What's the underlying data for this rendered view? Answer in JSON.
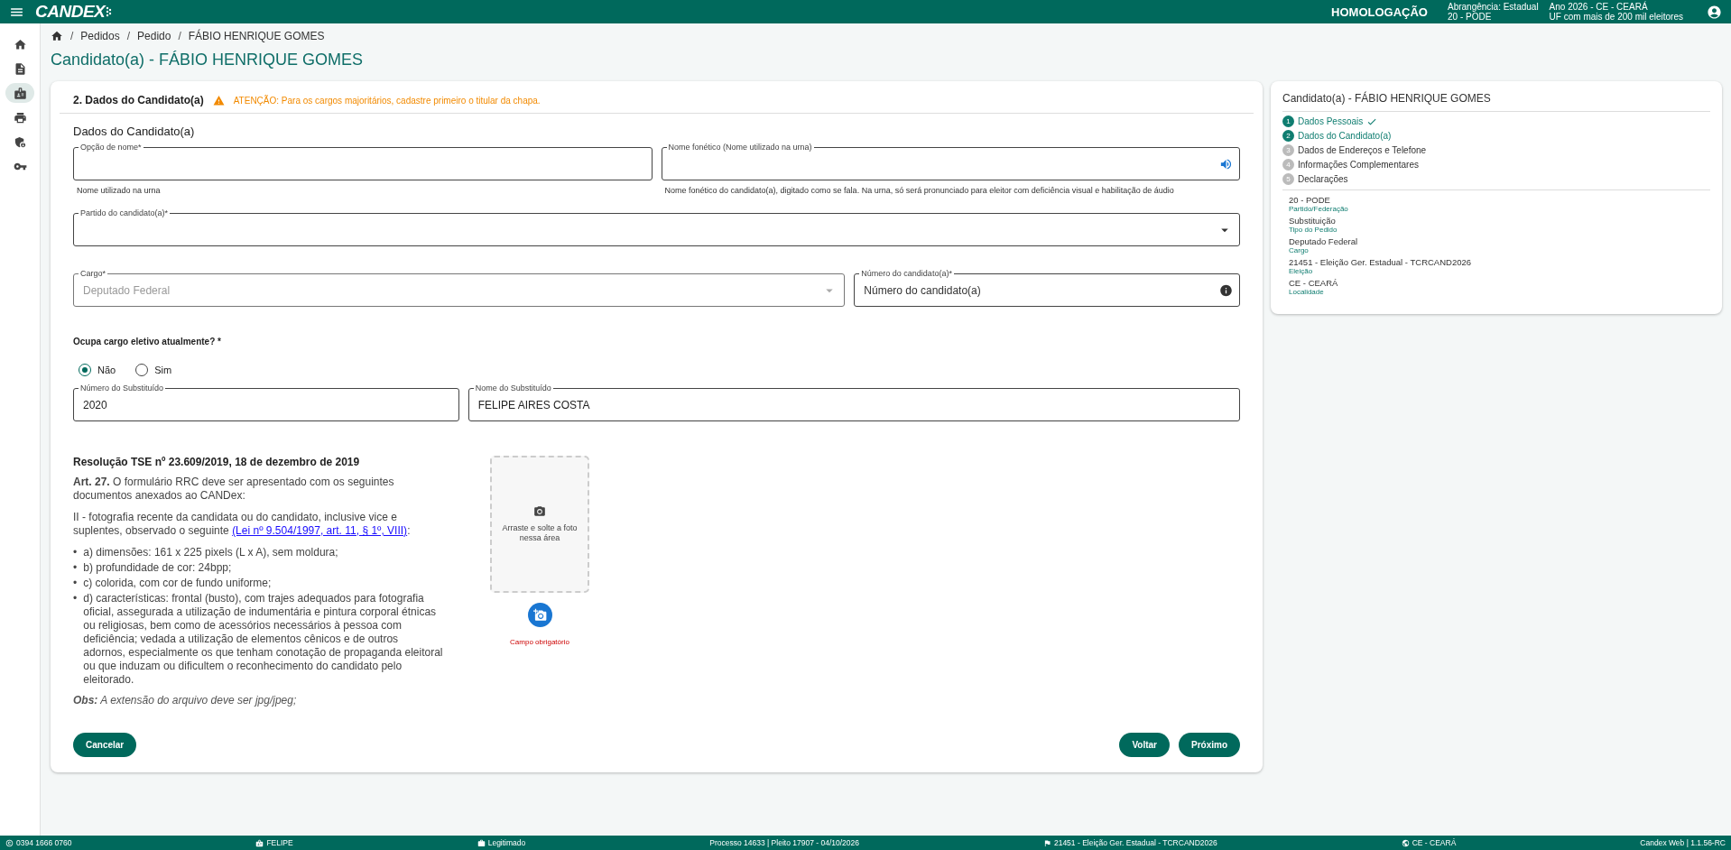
{
  "header": {
    "logo": "CANDEX",
    "environment": "HOMOLOGAÇÃO",
    "scope_lines": [
      "Abrangência: Estadual",
      "20 - PODE"
    ],
    "context_lines": [
      "Ano 2026 - CE - CEARÁ",
      "UF com mais de 200 mil eleitores"
    ]
  },
  "sidebar": {
    "items": [
      {
        "selected": false
      },
      {
        "selected": false
      },
      {
        "selected": true
      },
      {
        "selected": false
      },
      {
        "selected": false
      },
      {
        "selected": false
      }
    ]
  },
  "breadcrumb": {
    "separator": "/",
    "items": [
      "Pedidos",
      "Pedido",
      "FÁBIO HENRIQUE GOMES"
    ]
  },
  "page_title": "Candidato(a) - FÁBIO HENRIQUE GOMES",
  "form": {
    "section_title": "2. Dados do Candidato(a)",
    "warning": "ATENÇÃO: Para os cargos majoritários, cadastre primeiro o titular da chapa.",
    "subtitle": "Dados do Candidato(a)",
    "rows": [
      [
        {
          "kind": "text",
          "label": "Opção de nome*",
          "helper": "Nome utilizado na urna",
          "disabled": false
        },
        {
          "kind": "audio",
          "label": "Nome fonético (Nome utilizado na urna)",
          "helper": "Nome fonético do candidato(a), digitado como se fala. Na urna, só será pronunciado para eleitor com deficiência visual e habilitação de áudio",
          "disabled": false
        }
      ],
      [
        {
          "kind": "select",
          "label": "Partido do candidato(a)*",
          "disabled": false
        }
      ],
      [
        {
          "kind": "select",
          "label": "Cargo*",
          "value": "Deputado Federal",
          "disabled": true
        },
        {
          "kind": "info",
          "label": "Número do candidato(a)*",
          "placeholder": "Número do candidato(a)",
          "disabled": false
        }
      ]
    ],
    "question": "Ocupa cargo eletivo atualmente? *",
    "options": [
      {
        "label": "Não",
        "selected": true
      },
      {
        "label": "Sim",
        "selected": false
      }
    ],
    "substitute": [
      {
        "kind": "text",
        "label": "Número do Substituído",
        "value": "2020",
        "disabled": false
      },
      {
        "kind": "text",
        "label": "Nome do Substituído",
        "value": "FELIPE AIRES COSTA",
        "disabled": false
      }
    ],
    "resolution": {
      "title": "Resolução TSE nº 23.609/2019, 18 de dezembro de 2019",
      "article": "**Art. 27.** O formulário RRC deve ser apresentado com os seguintes documentos anexados ao CANDex:",
      "item": {
        "text": "II - fotografia recente da candidata ou do candidato, inclusive vice e suplentes, observado o seguinte ",
        "link": "(Lei nº 9.504/1997, art. 11, § 1º, VIII)",
        "suffix": ":"
      },
      "bullet": "•",
      "bullets": [
        "a) dimensões: 161 x 225 pixels (L x A), sem moldura;",
        "b) profundidade de cor: 24bpp;",
        "c) colorida, com cor de fundo uniforme;",
        "d) características: frontal (busto), com trajes adequados para fotografia oficial, assegurada a utilização de indumentária e pintura corporal étnicas ou religiosas, bem como de acessórios necessários à pessoa com deficiência; vedada a utilização de elementos cênicos e de outros adornos, especialmente os que tenham conotação de propaganda eleitoral ou que induzam ou dificultem o reconhecimento do candidato pelo eleitorado."
      ],
      "note": "**Obs:** A extensão do arquivo deve ser jpg/jpeg;"
    },
    "upload": {
      "hint": "Arraste e solte a foto nessa área",
      "error": "Campo obrigatório"
    },
    "buttons": {
      "cancel": "Cancelar",
      "back": "Voltar",
      "next": "Próximo"
    }
  },
  "summary": {
    "title": "Candidato(a) - FÁBIO HENRIQUE GOMES",
    "steps": [
      {
        "number": "1",
        "label": "Dados Pessoais",
        "kind": "done"
      },
      {
        "number": "2",
        "label": "Dados do Candidato(a)",
        "kind": "current"
      },
      {
        "number": "3",
        "label": "Dados de Endereços e Telefone",
        "kind": "pending"
      },
      {
        "number": "4",
        "label": "Informações Complementares",
        "kind": "pending"
      },
      {
        "number": "5",
        "label": "Declarações",
        "kind": "pending"
      }
    ],
    "details": [
      {
        "value": "20 - PODE",
        "caption": "Partido/Federação"
      },
      {
        "value": "Substituição",
        "caption": "Tipo do Pedido"
      },
      {
        "value": "Deputado Federal",
        "caption": "Cargo"
      },
      {
        "value": "21451 - Eleição Ger. Estadual - TCRCAND2026",
        "caption": "Eleição"
      },
      {
        "value": "CE - CEARÁ",
        "caption": "Localidade"
      }
    ]
  },
  "status_bar": [
    "0394 1666 0760",
    "FELIPE",
    "Legitimado",
    "Processo 14633 | Pleito 17907 - 04/10/2026",
    "21451 - Eleição Ger. Estadual - TCRCAND2026",
    "CE - CEARÁ",
    "Candex Web | 1.1.56-RC"
  ]
}
